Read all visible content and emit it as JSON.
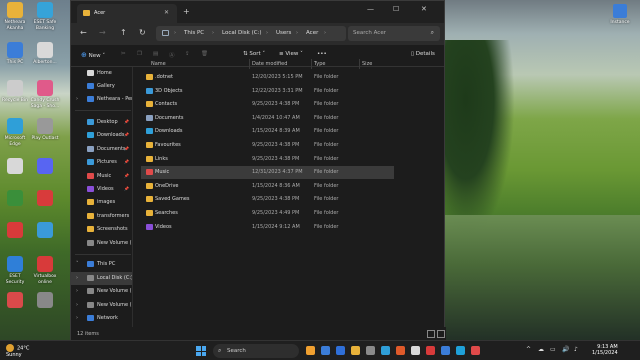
{
  "desktop": {
    "icons": [
      {
        "label": "Netheara Akanha",
        "color": "#e8b23a"
      },
      {
        "label": "ESET Safe Banking",
        "color": "#36a3d9"
      },
      {
        "label": "This PC",
        "color": "#3b7dd8"
      },
      {
        "label": "Alberton...",
        "color": "#d9d9d9"
      },
      {
        "label": "Recycle Bin",
        "color": "#cccccc"
      },
      {
        "label": "Candy Crush Saga - Sho...",
        "color": "#e05a8a"
      },
      {
        "label": "Microsoft Edge",
        "color": "#2f9fd8"
      },
      {
        "label": "Play Outlast",
        "color": "#999999"
      },
      {
        "label": "",
        "color": "#d8d8d8"
      },
      {
        "label": "",
        "color": "#5865f2"
      },
      {
        "label": "",
        "color": "#3a8f3a"
      },
      {
        "label": "",
        "color": "#d83b3b"
      },
      {
        "label": "",
        "color": "#d93a3a"
      },
      {
        "label": "",
        "color": "#3a9ad9"
      },
      {
        "label": "ESET Security",
        "color": "#2f7fd8"
      },
      {
        "label": "Virtualbox online",
        "color": "#d83a3a"
      },
      {
        "label": "",
        "color": "#d94a4a"
      },
      {
        "label": "",
        "color": "#888888"
      }
    ],
    "right_icon": {
      "label": "Instance"
    }
  },
  "window": {
    "tab_title": "Acer",
    "new_tab": "+",
    "controls": [
      "—",
      "☐",
      "✕"
    ]
  },
  "address": {
    "crumbs": [
      "This PC",
      "Local Disk (C:)",
      "Users",
      "Acer"
    ],
    "search_placeholder": "Search Acer"
  },
  "toolbar": {
    "new_label": "New",
    "sort_label": "Sort",
    "view_label": "View",
    "more_label": "•••",
    "details_label": "Details"
  },
  "nav_pane": {
    "top": [
      {
        "label": "Home",
        "color": "#d9d9d9",
        "expand": false
      },
      {
        "label": "Gallery",
        "color": "#3b7dd8",
        "expand": false
      },
      {
        "label": "Netheara - Perso",
        "color": "#3b7dd8",
        "expand": true
      }
    ],
    "quick": [
      {
        "label": "Desktop",
        "color": "#3b9ad9",
        "pinned": true
      },
      {
        "label": "Downloads",
        "color": "#2fa0d9",
        "pinned": true
      },
      {
        "label": "Documents",
        "color": "#8aa0c0",
        "pinned": true
      },
      {
        "label": "Pictures",
        "color": "#3b9ad9",
        "pinned": true
      },
      {
        "label": "Music",
        "color": "#e04a4a",
        "pinned": true
      },
      {
        "label": "Videos",
        "color": "#8a4fd8",
        "pinned": true
      },
      {
        "label": "images",
        "color": "#e8b23a",
        "pinned": false
      },
      {
        "label": "transformers",
        "color": "#e8b23a",
        "pinned": false
      },
      {
        "label": "Screenshots",
        "color": "#e8b23a",
        "pinned": false
      },
      {
        "label": "New Volume (E:",
        "color": "#888888",
        "pinned": false
      }
    ],
    "pc": [
      {
        "label": "This PC",
        "color": "#3b7dd8",
        "selected": false
      },
      {
        "label": "Local Disk (C:)",
        "color": "#888888",
        "selected": true
      },
      {
        "label": "New Volume (I",
        "color": "#888888",
        "selected": false
      },
      {
        "label": "New Volume (I",
        "color": "#888888",
        "selected": false
      },
      {
        "label": "Network",
        "color": "#3b7dd8",
        "selected": false
      }
    ]
  },
  "columns": {
    "name": "Name",
    "date": "Date modified",
    "type": "Type",
    "size": "Size"
  },
  "files": [
    {
      "name": ".dotnet",
      "date": "12/20/2023 5:15 PM",
      "type": "File folder",
      "icon": "#e8b23a"
    },
    {
      "name": "3D Objects",
      "date": "12/22/2023 3:31 PM",
      "type": "File folder",
      "icon": "#3b9ad9"
    },
    {
      "name": "Contacts",
      "date": "9/25/2023 4:38 PM",
      "type": "File folder",
      "icon": "#e8b23a"
    },
    {
      "name": "Documents",
      "date": "1/4/2024 10:47 AM",
      "type": "File folder",
      "icon": "#8aa0c0"
    },
    {
      "name": "Downloads",
      "date": "1/15/2024 8:39 AM",
      "type": "File folder",
      "icon": "#2fa0d9"
    },
    {
      "name": "Favourites",
      "date": "9/25/2023 4:38 PM",
      "type": "File folder",
      "icon": "#e8b23a"
    },
    {
      "name": "Links",
      "date": "9/25/2023 4:38 PM",
      "type": "File folder",
      "icon": "#e8b23a"
    },
    {
      "name": "Music",
      "date": "12/31/2023 4:37 PM",
      "type": "File folder",
      "icon": "#e04a4a"
    },
    {
      "name": "OneDrive",
      "date": "1/15/2024 8:36 AM",
      "type": "File folder",
      "icon": "#e8b23a"
    },
    {
      "name": "Saved Games",
      "date": "9/25/2023 4:38 PM",
      "type": "File folder",
      "icon": "#e8b23a"
    },
    {
      "name": "Searches",
      "date": "9/25/2023 4:49 PM",
      "type": "File folder",
      "icon": "#e8b23a"
    },
    {
      "name": "Videos",
      "date": "1/15/2024 9:12 AM",
      "type": "File folder",
      "icon": "#8a4fd8"
    }
  ],
  "selected_file": "Music",
  "status": {
    "count": "12 items"
  },
  "taskbar": {
    "weather_temp": "24°C",
    "weather_desc": "Sunny",
    "search_label": "Search",
    "apps": [
      "#f0a030",
      "#3b7dd8",
      "#2f6fd8",
      "#e8b23a",
      "#8a8a8a",
      "#2f9fd8",
      "#e05a2a",
      "#d9d9d9",
      "#d83a3a",
      "#3b7dd8",
      "#1fa0d8",
      "#e04a4a"
    ],
    "tray": [
      "^",
      "☁",
      "▭",
      "🔊",
      "♪"
    ],
    "time": "9:13 AM",
    "date": "1/15/2024"
  }
}
